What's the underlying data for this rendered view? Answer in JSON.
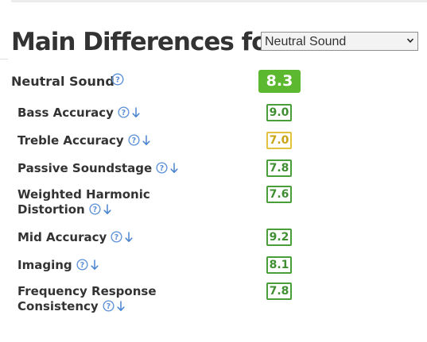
{
  "page_title": "Main Differences for",
  "test_select": {
    "selected": "Neutral Sound"
  },
  "summary": {
    "label": "Neutral Sound",
    "score": "8.3",
    "score_color": "#5cb82e"
  },
  "criteria": [
    {
      "label": "Bass Accuracy",
      "score": "9.0",
      "level": "good"
    },
    {
      "label": "Treble Accuracy",
      "score": "7.0",
      "level": "warn"
    },
    {
      "label": "Passive Soundstage",
      "score": "7.8",
      "level": "good"
    },
    {
      "label": "Weighted Harmonic Distortion",
      "score": "7.6",
      "level": "good"
    },
    {
      "label": "Mid Accuracy",
      "score": "9.2",
      "level": "good"
    },
    {
      "label": "Imaging",
      "score": "8.1",
      "level": "good"
    },
    {
      "label": "Frequency Response Consistency",
      "score": "7.8",
      "level": "good"
    }
  ],
  "colors": {
    "good_score": "#4a9e3a",
    "warn_score": "#e3c23e",
    "help_icon": "#5b8fd6",
    "arrow_icon": "#4a84cf"
  },
  "icons": {
    "help": "question-circle-icon",
    "arrow": "arrow-down-icon",
    "dropdown": "chevron-down-icon"
  }
}
